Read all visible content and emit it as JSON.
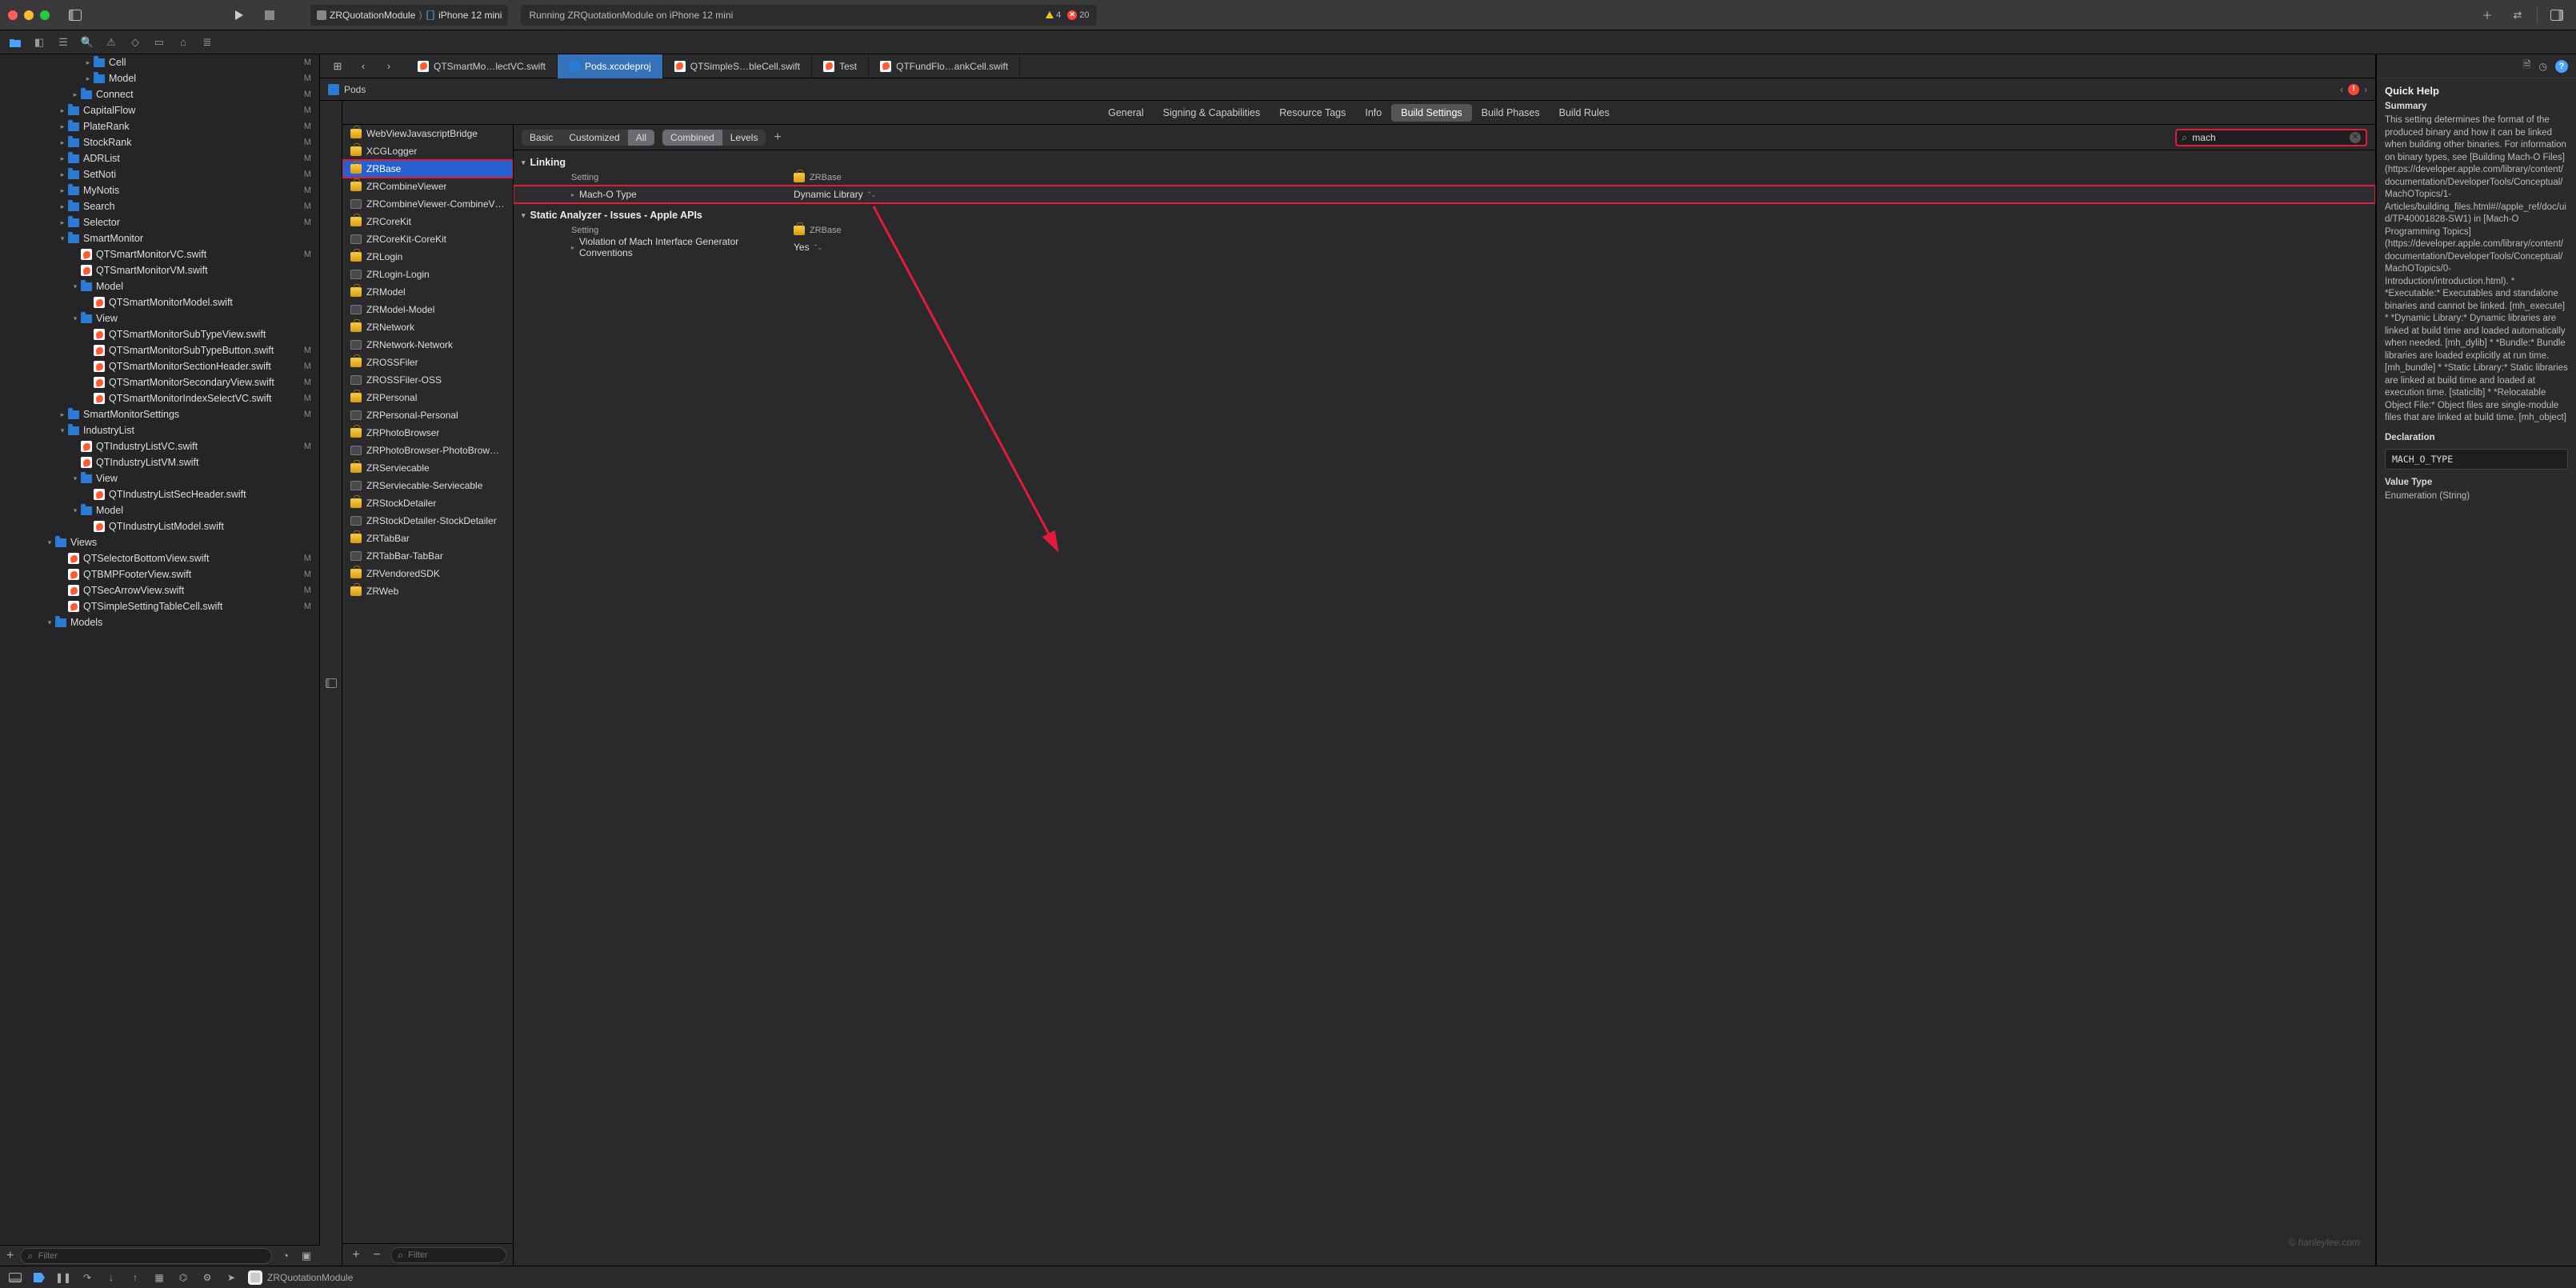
{
  "toolbar": {
    "scheme": "ZRQuotationModule",
    "device": "iPhone 12 mini",
    "status": "Running ZRQuotationModule on iPhone 12 mini",
    "warnings": "4",
    "errors": "20"
  },
  "tabs": [
    {
      "label": "QTSmartMo…lectVC.swift",
      "kind": "swift"
    },
    {
      "label": "Pods.xcodeproj",
      "kind": "xcodeproj",
      "active": true
    },
    {
      "label": "QTSimpleS…bleCell.swift",
      "kind": "swift"
    },
    {
      "label": "Test",
      "kind": "swift"
    },
    {
      "label": "QTFundFlo…ankCell.swift",
      "kind": "swift"
    }
  ],
  "breadcrumb": {
    "item": "Pods"
  },
  "proj_tabs": {
    "items": [
      "General",
      "Signing & Capabilities",
      "Resource Tags",
      "Info",
      "Build Settings",
      "Build Phases",
      "Build Rules"
    ],
    "active": "Build Settings"
  },
  "filter_bar": {
    "scope": [
      "Basic",
      "Customized",
      "All"
    ],
    "scope_active": "All",
    "view": [
      "Combined",
      "Levels"
    ],
    "view_active": "Combined",
    "search": "mach"
  },
  "sections": [
    {
      "title": "Linking",
      "column_target": "ZRBase",
      "column_label": "Setting",
      "rows": [
        {
          "name": "Mach-O Type",
          "value": "Dynamic Library",
          "highlight": true
        }
      ]
    },
    {
      "title": "Static Analyzer - Issues - Apple APIs",
      "column_target": "ZRBase",
      "column_label": "Setting",
      "rows": [
        {
          "name": "Violation of Mach Interface Generator Conventions",
          "value": "Yes"
        }
      ]
    }
  ],
  "file_tree": [
    {
      "d": 4,
      "kind": "folder",
      "name": "Cell",
      "m": "M",
      "disclose": "▸"
    },
    {
      "d": 4,
      "kind": "folder",
      "name": "Model",
      "m": "M",
      "disclose": "▸"
    },
    {
      "d": 3,
      "kind": "folder",
      "name": "Connect",
      "m": "M",
      "disclose": "▸"
    },
    {
      "d": 2,
      "kind": "folder",
      "name": "CapitalFlow",
      "m": "M",
      "disclose": "▸"
    },
    {
      "d": 2,
      "kind": "folder",
      "name": "PlateRank",
      "m": "M",
      "disclose": "▸"
    },
    {
      "d": 2,
      "kind": "folder",
      "name": "StockRank",
      "m": "M",
      "disclose": "▸"
    },
    {
      "d": 2,
      "kind": "folder",
      "name": "ADRList",
      "m": "M",
      "disclose": "▸"
    },
    {
      "d": 2,
      "kind": "folder",
      "name": "SetNoti",
      "m": "M",
      "disclose": "▸"
    },
    {
      "d": 2,
      "kind": "folder",
      "name": "MyNotis",
      "m": "M",
      "disclose": "▸"
    },
    {
      "d": 2,
      "kind": "folder",
      "name": "Search",
      "m": "M",
      "disclose": "▸"
    },
    {
      "d": 2,
      "kind": "folder",
      "name": "Selector",
      "m": "M",
      "disclose": "▸"
    },
    {
      "d": 2,
      "kind": "folder",
      "name": "SmartMonitor",
      "m": "",
      "disclose": "▾"
    },
    {
      "d": 3,
      "kind": "swift",
      "name": "QTSmartMonitorVC.swift",
      "m": "M"
    },
    {
      "d": 3,
      "kind": "swift",
      "name": "QTSmartMonitorVM.swift",
      "m": ""
    },
    {
      "d": 3,
      "kind": "folder",
      "name": "Model",
      "m": "",
      "disclose": "▾"
    },
    {
      "d": 4,
      "kind": "swift",
      "name": "QTSmartMonitorModel.swift",
      "m": ""
    },
    {
      "d": 3,
      "kind": "folder",
      "name": "View",
      "m": "",
      "disclose": "▾"
    },
    {
      "d": 4,
      "kind": "swift",
      "name": "QTSmartMonitorSubTypeView.swift",
      "m": ""
    },
    {
      "d": 4,
      "kind": "swift",
      "name": "QTSmartMonitorSubTypeButton.swift",
      "m": "M"
    },
    {
      "d": 4,
      "kind": "swift",
      "name": "QTSmartMonitorSectionHeader.swift",
      "m": "M"
    },
    {
      "d": 4,
      "kind": "swift",
      "name": "QTSmartMonitorSecondaryView.swift",
      "m": "M"
    },
    {
      "d": 4,
      "kind": "swift",
      "name": "QTSmartMonitorIndexSelectVC.swift",
      "m": "M"
    },
    {
      "d": 2,
      "kind": "folder",
      "name": "SmartMonitorSettings",
      "m": "M",
      "disclose": "▸"
    },
    {
      "d": 2,
      "kind": "folder",
      "name": "IndustryList",
      "m": "",
      "disclose": "▾"
    },
    {
      "d": 3,
      "kind": "swift",
      "name": "QTIndustryListVC.swift",
      "m": "M"
    },
    {
      "d": 3,
      "kind": "swift",
      "name": "QTIndustryListVM.swift",
      "m": ""
    },
    {
      "d": 3,
      "kind": "folder",
      "name": "View",
      "m": "",
      "disclose": "▾"
    },
    {
      "d": 4,
      "kind": "swift",
      "name": "QTIndustryListSecHeader.swift",
      "m": ""
    },
    {
      "d": 3,
      "kind": "folder",
      "name": "Model",
      "m": "",
      "disclose": "▾"
    },
    {
      "d": 4,
      "kind": "swift",
      "name": "QTIndustryListModel.swift",
      "m": ""
    },
    {
      "d": 1,
      "kind": "folder",
      "name": "Views",
      "m": "",
      "disclose": "▾"
    },
    {
      "d": 2,
      "kind": "swift",
      "name": "QTSelectorBottomView.swift",
      "m": "M"
    },
    {
      "d": 2,
      "kind": "swift",
      "name": "QTBMPFooterView.swift",
      "m": "M"
    },
    {
      "d": 2,
      "kind": "swift",
      "name": "QTSecArrowView.swift",
      "m": "M"
    },
    {
      "d": 2,
      "kind": "swift",
      "name": "QTSimpleSettingTableCell.swift",
      "m": "M"
    },
    {
      "d": 1,
      "kind": "folder",
      "name": "Models",
      "m": "",
      "disclose": "▾"
    }
  ],
  "targets": [
    {
      "name": "WebViewJavascriptBridge",
      "kind": "bundle"
    },
    {
      "name": "XCGLogger",
      "kind": "bundle"
    },
    {
      "name": "ZRBase",
      "kind": "bundle",
      "selected": true
    },
    {
      "name": "ZRCombineViewer",
      "kind": "bundle"
    },
    {
      "name": "ZRCombineViewer-CombineV…",
      "kind": "fw"
    },
    {
      "name": "ZRCoreKit",
      "kind": "bundle"
    },
    {
      "name": "ZRCoreKit-CoreKit",
      "kind": "fw"
    },
    {
      "name": "ZRLogin",
      "kind": "bundle"
    },
    {
      "name": "ZRLogin-Login",
      "kind": "fw"
    },
    {
      "name": "ZRModel",
      "kind": "bundle"
    },
    {
      "name": "ZRModel-Model",
      "kind": "fw"
    },
    {
      "name": "ZRNetwork",
      "kind": "bundle"
    },
    {
      "name": "ZRNetwork-Network",
      "kind": "fw"
    },
    {
      "name": "ZROSSFiler",
      "kind": "bundle"
    },
    {
      "name": "ZROSSFiler-OSS",
      "kind": "fw"
    },
    {
      "name": "ZRPersonal",
      "kind": "bundle"
    },
    {
      "name": "ZRPersonal-Personal",
      "kind": "fw"
    },
    {
      "name": "ZRPhotoBrowser",
      "kind": "bundle"
    },
    {
      "name": "ZRPhotoBrowser-PhotoBrow…",
      "kind": "fw"
    },
    {
      "name": "ZRServiecable",
      "kind": "bundle"
    },
    {
      "name": "ZRServiecable-Serviecable",
      "kind": "fw"
    },
    {
      "name": "ZRStockDetailer",
      "kind": "bundle"
    },
    {
      "name": "ZRStockDetailer-StockDetailer",
      "kind": "fw"
    },
    {
      "name": "ZRTabBar",
      "kind": "bundle"
    },
    {
      "name": "ZRTabBar-TabBar",
      "kind": "fw"
    },
    {
      "name": "ZRVendoredSDK",
      "kind": "bundle"
    },
    {
      "name": "ZRWeb",
      "kind": "bundle"
    }
  ],
  "targets_filter_placeholder": "Filter",
  "filenav_filter_placeholder": "Filter",
  "inspector": {
    "title": "Quick Help",
    "summary_label": "Summary",
    "summary_text": "This setting determines the format of the produced binary and how it can be linked when building other binaries. For information on binary types, see [Building Mach-O Files](https://developer.apple.com/library/content/documentation/DeveloperTools/Conceptual/MachOTopics/1-Articles/building_files.html#//apple_ref/doc/uid/TP40001828-SW1) in [Mach-O Programming Topics](https://developer.apple.com/library/content/documentation/DeveloperTools/Conceptual/MachOTopics/0-Introduction/introduction.html). * *Executable:* Executables and standalone binaries and cannot be linked. [mh_execute] * *Dynamic Library:* Dynamic libraries are linked at build time and loaded automatically when needed. [mh_dylib] * *Bundle:* Bundle libraries are loaded explicitly at run time. [mh_bundle] * *Static Library:* Static libraries are linked at build time and loaded at execution time. [staticlib] * *Relocatable Object File:* Object files are single-module files that are linked at build time. [mh_object]",
    "declaration_label": "Declaration",
    "declaration_value": "MACH_O_TYPE",
    "valuetype_label": "Value Type",
    "valuetype_value": "Enumeration (String)"
  },
  "bottom": {
    "process": "ZRQuotationModule"
  },
  "watermark": "© hanleylee.com"
}
